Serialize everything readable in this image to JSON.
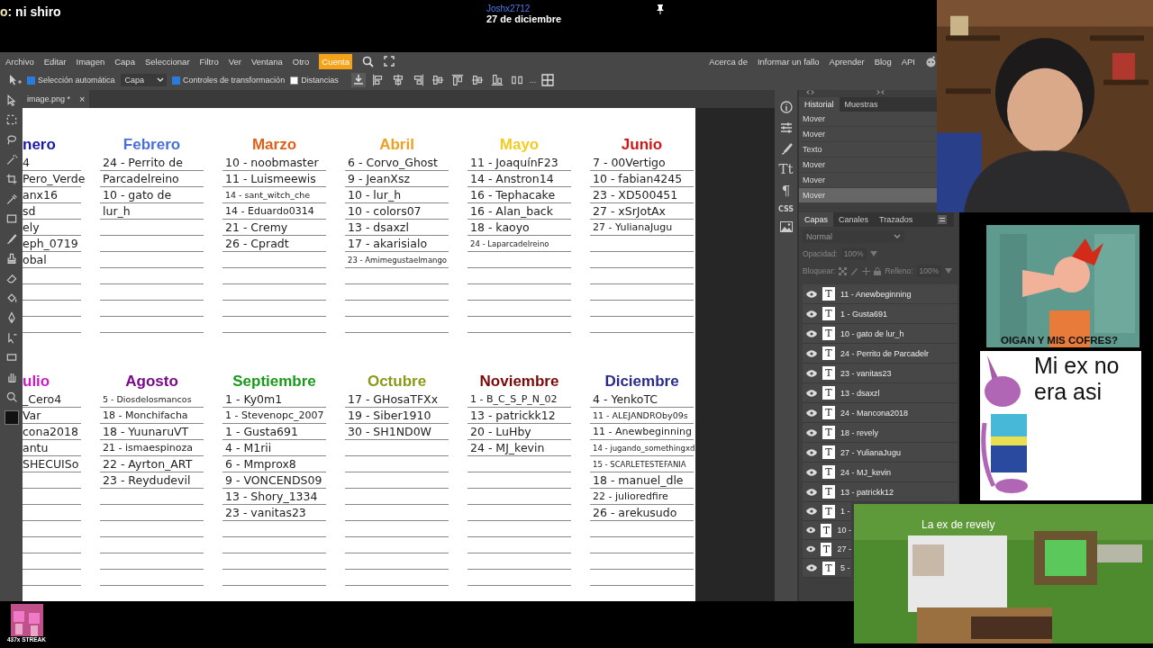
{
  "stream_header": {
    "chat_user": "o",
    "chat_message": ": ni shiro",
    "user": "Joshx2712",
    "date": "27 de diciembre"
  },
  "menu": {
    "items": [
      {
        "label": "Archivo",
        "highlighted": false
      },
      {
        "label": "Editar",
        "highlighted": false
      },
      {
        "label": "Imagen",
        "highlighted": false
      },
      {
        "label": "Capa",
        "highlighted": false
      },
      {
        "label": "Seleccionar",
        "highlighted": false
      },
      {
        "label": "Filtro",
        "highlighted": false
      },
      {
        "label": "Ver",
        "highlighted": false
      },
      {
        "label": "Ventana",
        "highlighted": false
      },
      {
        "label": "Otro",
        "highlighted": false
      },
      {
        "label": "Cuenta",
        "highlighted": true
      }
    ],
    "right_links": [
      "Acerca de",
      "Informar un fallo",
      "Aprender",
      "Blog",
      "API"
    ]
  },
  "options": {
    "checks": [
      {
        "label": "Selección automática",
        "checked": true
      },
      {
        "label": "Controles de transformación",
        "checked": true
      },
      {
        "label": "Distancias",
        "checked": false
      }
    ],
    "target": "Capa",
    "more": "..."
  },
  "document_tab": {
    "title": "image.png *",
    "close": "×"
  },
  "calendar": {
    "rows": [
      {
        "months": [
          {
            "name": "nero",
            "color": "#1a1aa8",
            "entries": [
              "4",
              "Pero_Verde",
              "anx16",
              "sd",
              "ely",
              "eph_0719",
              "obal"
            ]
          },
          {
            "name": "Febrero",
            "color": "#4a6fd8",
            "entries": [
              "24 - Perrito de",
              "Parcadelreino",
              "10 - gato de",
              "lur_h"
            ]
          },
          {
            "name": "Marzo",
            "color": "#e0601a",
            "entries": [
              "10 - noobmaster",
              "11 - Luismeewis",
              "14 - sant_witch_che",
              "14 - Eduardo0314",
              "21 - Cremy",
              "26 - Cpradt"
            ]
          },
          {
            "name": "Abril",
            "color": "#f0a020",
            "entries": [
              "6 - Corvo_Ghost",
              "9 - JeanXsz",
              "10 - lur_h",
              "10 - colors07",
              "13 - dsaxzl",
              "17 - akarisialo",
              "23 - Amimegustaelmango"
            ]
          },
          {
            "name": "Mayo",
            "color": "#f2cc20",
            "entries": [
              "11 - JoaquínF23",
              "14 - Anstron14",
              "16 - Tephacake",
              "16 - Alan_back",
              "18 - kaoyo",
              "24 - Laparcadelreino"
            ]
          },
          {
            "name": "Junio",
            "color": "#d01818",
            "entries": [
              "7 - 00Vertigo",
              "10 - fabian4245",
              "23 - XD500451",
              "27 - xSrJotAx",
              "27 - YulianaJugu"
            ]
          }
        ]
      },
      {
        "months": [
          {
            "name": "ulio",
            "color": "#c81ec8",
            "entries": [
              "_Cero4",
              "Var",
              "cona2018",
              "antu",
              "SHECUISo"
            ]
          },
          {
            "name": "Agosto",
            "color": "#7a0a8a",
            "entries": [
              "5 - Diosdelosmancos",
              "18 - Monchifacha",
              "18 - YuunaruVT",
              "21 - ismaespinoza",
              "22 - Ayrton_ART",
              "23 - Reydudevil"
            ]
          },
          {
            "name": "Septiembre",
            "color": "#1a9a1a",
            "entries": [
              "1 - Ky0m1",
              "1 - Stevenopc_2007",
              "1 - Gusta691",
              "4 - M1rii",
              "6 - Mmprox8",
              "9 - VONCENDS09",
              "13 - Shory_1334",
              "23 - vanitas23"
            ]
          },
          {
            "name": "Octubre",
            "color": "#8a9a18",
            "entries": [
              "17 - GHosaTFXx",
              "19 - Siber1910",
              "30 - SH1ND0W"
            ]
          },
          {
            "name": "Noviembre",
            "color": "#7a0a0a",
            "entries": [
              "1 - B_C_S_P_N_02",
              "13 - patrickk12",
              "20 - LuHby",
              "24 - MJ_kevin"
            ]
          },
          {
            "name": "Diciembre",
            "color": "#2a2a8a",
            "entries": [
              "4 - YenkoTC",
              "11 - ALEJANDROby09s",
              "11 - Anewbeginning",
              "14 - jugando_somethingxd",
              "15 - SCARLETESTEFANIA",
              "18 - manuel_dle",
              "22 - julioredfire",
              "26 - arekusudo"
            ]
          }
        ]
      }
    ]
  },
  "side_icons": [
    "Tt",
    "¶",
    "CSS"
  ],
  "history": {
    "tabs": [
      {
        "label": "Historial",
        "selected": true
      },
      {
        "label": "Muestras",
        "selected": false
      }
    ],
    "items": [
      {
        "label": "Mover",
        "selected": false
      },
      {
        "label": "Mover",
        "selected": false
      },
      {
        "label": "Texto",
        "selected": false
      },
      {
        "label": "Mover",
        "selected": false
      },
      {
        "label": "Mover",
        "selected": false
      },
      {
        "label": "Mover",
        "selected": true
      }
    ]
  },
  "layers": {
    "tabs": [
      {
        "label": "Capas",
        "selected": true
      },
      {
        "label": "Canales",
        "selected": false
      },
      {
        "label": "Trazados",
        "selected": false
      }
    ],
    "blend_mode": "Normal",
    "opacity_label": "Opacidad:",
    "opacity": "100%",
    "lock_label": "Bloquear:",
    "fill_label": "Relleno:",
    "fill": "100%",
    "items": [
      {
        "name": "11 - Anewbeginning",
        "thumb": "T"
      },
      {
        "name": "1 - Gusta691",
        "thumb": "T"
      },
      {
        "name": "10 - gato de lur_h",
        "thumb": "T"
      },
      {
        "name": "24 - Perrito de Parcadelr",
        "thumb": "T"
      },
      {
        "name": "23 - vanitas23",
        "thumb": "T"
      },
      {
        "name": "13 - dsaxzl",
        "thumb": "T"
      },
      {
        "name": "24 - Mancona2018",
        "thumb": "T"
      },
      {
        "name": "18 - revely",
        "thumb": "T"
      },
      {
        "name": "27 - YulianaJugu",
        "thumb": "T"
      },
      {
        "name": "24 - MJ_kevin",
        "thumb": "T"
      },
      {
        "name": "13 - patrickk12",
        "thumb": "T"
      }
    ],
    "covered_items": [
      {
        "name": "1 -",
        "thumb": "T"
      },
      {
        "name": "10 -",
        "thumb": "T"
      },
      {
        "name": "27 -",
        "thumb": "T"
      },
      {
        "name": "5 -",
        "thumb": "T"
      }
    ]
  },
  "overlays": {
    "memes": [
      {
        "caption": "OIGAN Y MIS COFRES?"
      },
      {
        "caption": "Mi ex no era asi"
      },
      {
        "caption": "La ex de revely"
      }
    ],
    "streak": "437x STREAK"
  }
}
